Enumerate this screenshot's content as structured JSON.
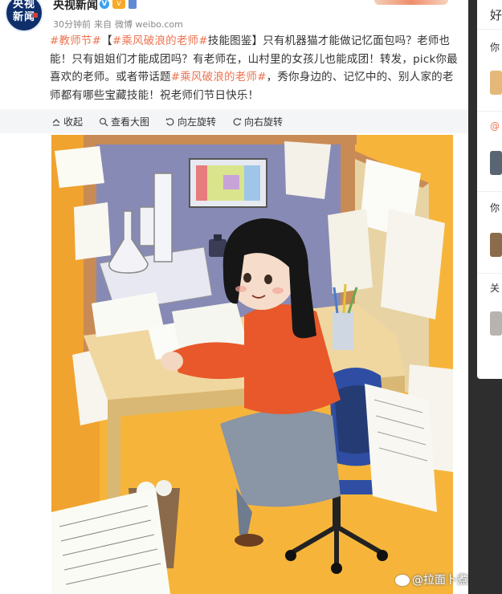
{
  "post": {
    "avatar_text": "央视\n新闻",
    "author": "央视新闻",
    "meta": {
      "time": "30分钟前",
      "from": "来自",
      "source": "微博 weibo.com"
    },
    "text_parts": [
      {
        "text": "#教师节#",
        "tag": true
      },
      {
        "text": "【",
        "tag": false
      },
      {
        "text": "#乘风破浪的老师#",
        "tag": true
      },
      {
        "text": "技能图鉴】只有机器猫才能做记忆面包吗？老师也能！只有姐姐们才能成团吗？有老师在，山村里的女孩儿也能成团！转发，pick你最喜欢的老师。或者带话题",
        "tag": false
      },
      {
        "text": "#乘风破浪的老师#",
        "tag": true
      },
      {
        "text": "，秀你身边的、记忆中的、别人家的老师都有哪些宝藏技能！祝老师们节日快乐！",
        "tag": false
      }
    ]
  },
  "toolbar": {
    "collapse": "收起",
    "view_large": "查看大图",
    "rotate_left": "向左旋转",
    "rotate_right": "向右旋转"
  },
  "watermark": "@拉面卜煮蛋",
  "sidebar": {
    "title": "好",
    "items": [
      "你",
      "@",
      "你",
      "关"
    ]
  },
  "colors": {
    "topic_link": "#eb7350",
    "toolbar_bg": "#f4f5f7",
    "page_bg": "#2e2e2e"
  }
}
